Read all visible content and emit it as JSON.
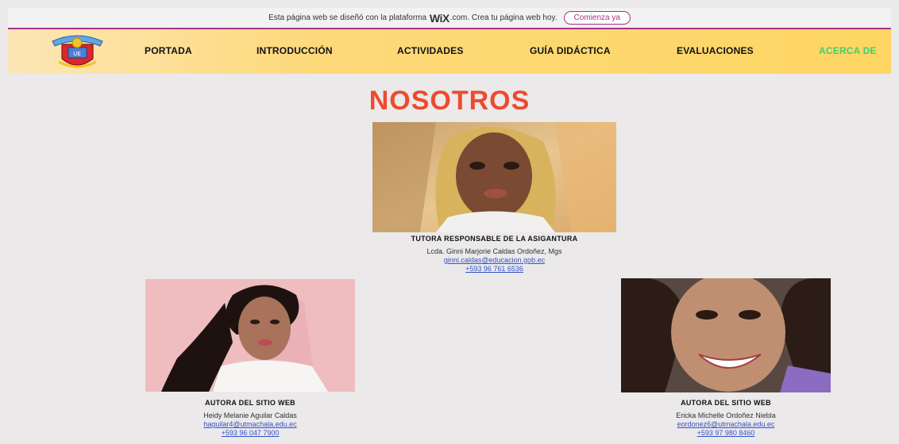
{
  "banner": {
    "text_before": "Esta página web se diseñó con la plataforma",
    "logo": "WiX",
    "text_after": ".com. Crea tu página web hoy.",
    "cta": "Comienza ya"
  },
  "nav": {
    "items": [
      "PORTADA",
      "INTRODUCCIÓN",
      "ACTIVIDADES",
      "GUÍA DIDÁCTICA",
      "EVALUACIONES",
      "ACERCA DE"
    ],
    "active_color": "#3fcf6a"
  },
  "page": {
    "title": "NOSOTROS",
    "title_color": "#ee4a2d"
  },
  "tutor": {
    "role": "TUTORA RESPONSABLE DE LA ASIGANTURA",
    "name": "Lcda. Ginni Marjorie Caldas Ordoñez, Mgs",
    "email": "ginni.caldas@educacion.gob.ec",
    "phone": "+593 96 761 6536"
  },
  "author1": {
    "role": "AUTORA DEL SITIO WEB",
    "name": "Heidy Melanie Aguilar Caldas",
    "email": "haguilar4@utmachala.edu.ec",
    "phone": "+593 96 047 7900"
  },
  "author2": {
    "role": "AUTORA DEL SITIO WEB",
    "name": "Ericka Michelle Ordoñez Niebla",
    "email": "eordonez6@utmachala.edu.ec",
    "phone": "+593 97 980 8460"
  }
}
